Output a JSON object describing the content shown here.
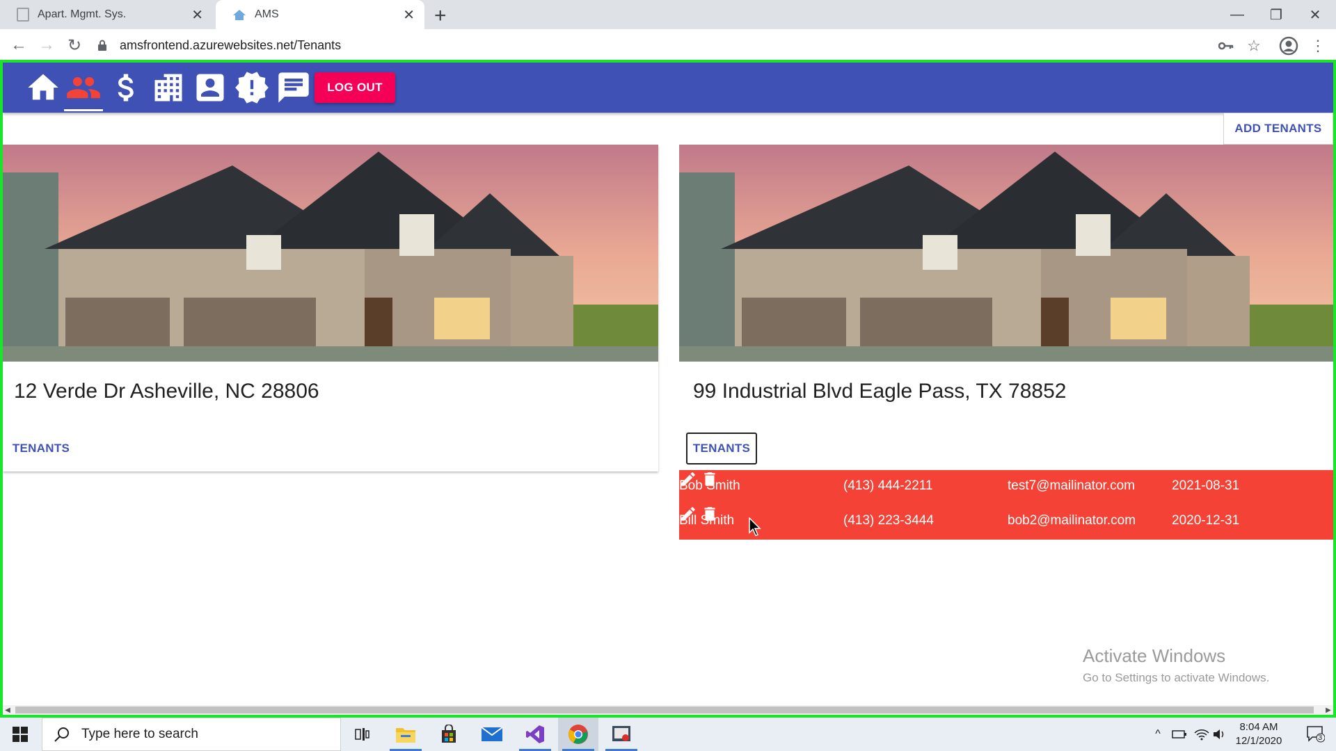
{
  "browser": {
    "tabs": [
      {
        "title": "Apart. Mgmt. Sys.",
        "active": false
      },
      {
        "title": "AMS",
        "active": true
      }
    ],
    "url": "amsfrontend.azurewebsites.net/Tenants"
  },
  "appbar": {
    "nav_icons": [
      "home-icon",
      "people-icon",
      "dollar-icon",
      "building-icon",
      "account-box-icon",
      "alert-decagram-icon",
      "message-icon"
    ],
    "active_nav": "people-icon",
    "logout_label": "LOG OUT",
    "color": "#3f51b5",
    "logout_color": "#f50057"
  },
  "page": {
    "add_tenants_label": "ADD TENANTS",
    "properties": [
      {
        "address": "12 Verde Dr Asheville, NC 28806",
        "tenants_label": "TENANTS",
        "expanded": false
      },
      {
        "address": "99 Industrial Blvd Eagle Pass, TX 78852",
        "tenants_label": "TENANTS",
        "expanded": true,
        "tenants": [
          {
            "name": "Bob Smith",
            "phone": "(413) 444-2211",
            "email": "test7@mailinator.com",
            "date": "2021-08-31"
          },
          {
            "name": "Bill Smith",
            "phone": "(413) 223-3444",
            "email": "bob2@mailinator.com",
            "date": "2020-12-31"
          }
        ]
      }
    ],
    "tenant_row_color": "#f44336"
  },
  "watermark": {
    "title": "Activate Windows",
    "subtitle": "Go to Settings to activate Windows."
  },
  "taskbar": {
    "search_placeholder": "Type here to search",
    "time": "8:04 AM",
    "date": "12/1/2020",
    "notification_count": "3"
  }
}
